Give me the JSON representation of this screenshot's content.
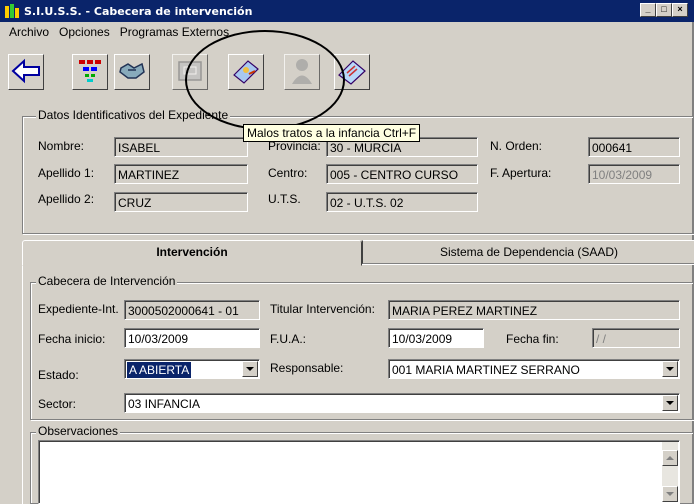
{
  "window": {
    "title": "S.I.U.S.S. - Cabecera de intervención",
    "controls": [
      "_",
      "□",
      "×"
    ]
  },
  "menu": [
    "Archivo",
    "Opciones",
    "Programas Externos"
  ],
  "toolbar": {
    "icons": [
      "back-arrow-icon",
      "org-chart-icon",
      "handshake-icon",
      "report-icon",
      "child-abuse-icon",
      "person-silhouette-icon",
      "card-icon"
    ]
  },
  "tooltip": "Malos tratos a la infancia Ctrl+F",
  "expediente": {
    "group_label": "Datos Identificativos del Expediente",
    "nombre_label": "Nombre:",
    "nombre": "ISABEL",
    "apellido1_label": "Apellido 1:",
    "apellido1": "MARTINEZ",
    "apellido2_label": "Apellido 2:",
    "apellido2": "CRUZ",
    "provincia_label": "Provincia:",
    "provincia": "30 - MURCIA",
    "centro_label": "Centro:",
    "centro": "005 - CENTRO CURSO",
    "uts_label": "U.T.S.",
    "uts": "02 - U.T.S. 02",
    "norden_label": "N. Orden:",
    "norden": "000641",
    "fapertura_label": "F. Apertura:",
    "fapertura": "10/03/2009"
  },
  "tabs": {
    "active": "Intervención",
    "inactive": "Sistema de Dependencia (SAAD)"
  },
  "cabecera": {
    "group_label": "Cabecera de Intervención",
    "expediente_int_label": "Expediente-Int.",
    "expediente_int": "3000502000641 - 01",
    "titular_label": "Titular Intervención:",
    "titular": "MARIA PEREZ MARTINEZ",
    "fecha_inicio_label": "Fecha inicio:",
    "fecha_inicio": "10/03/2009",
    "fua_label": "F.U.A.:",
    "fua": "10/03/2009",
    "fecha_fin_label": "Fecha fin:",
    "fecha_fin": "/ /",
    "estado_label": "Estado:",
    "estado": "A ABIERTA",
    "responsable_label": "Responsable:",
    "responsable": "001  MARIA MARTINEZ SERRANO",
    "sector_label": "Sector:",
    "sector": "03  INFANCIA"
  },
  "observaciones": {
    "group_label": "Observaciones"
  },
  "colors": {
    "titlebar": "#0a246a",
    "face": "#d4d0c8",
    "tooltip": "#ffffe1"
  }
}
